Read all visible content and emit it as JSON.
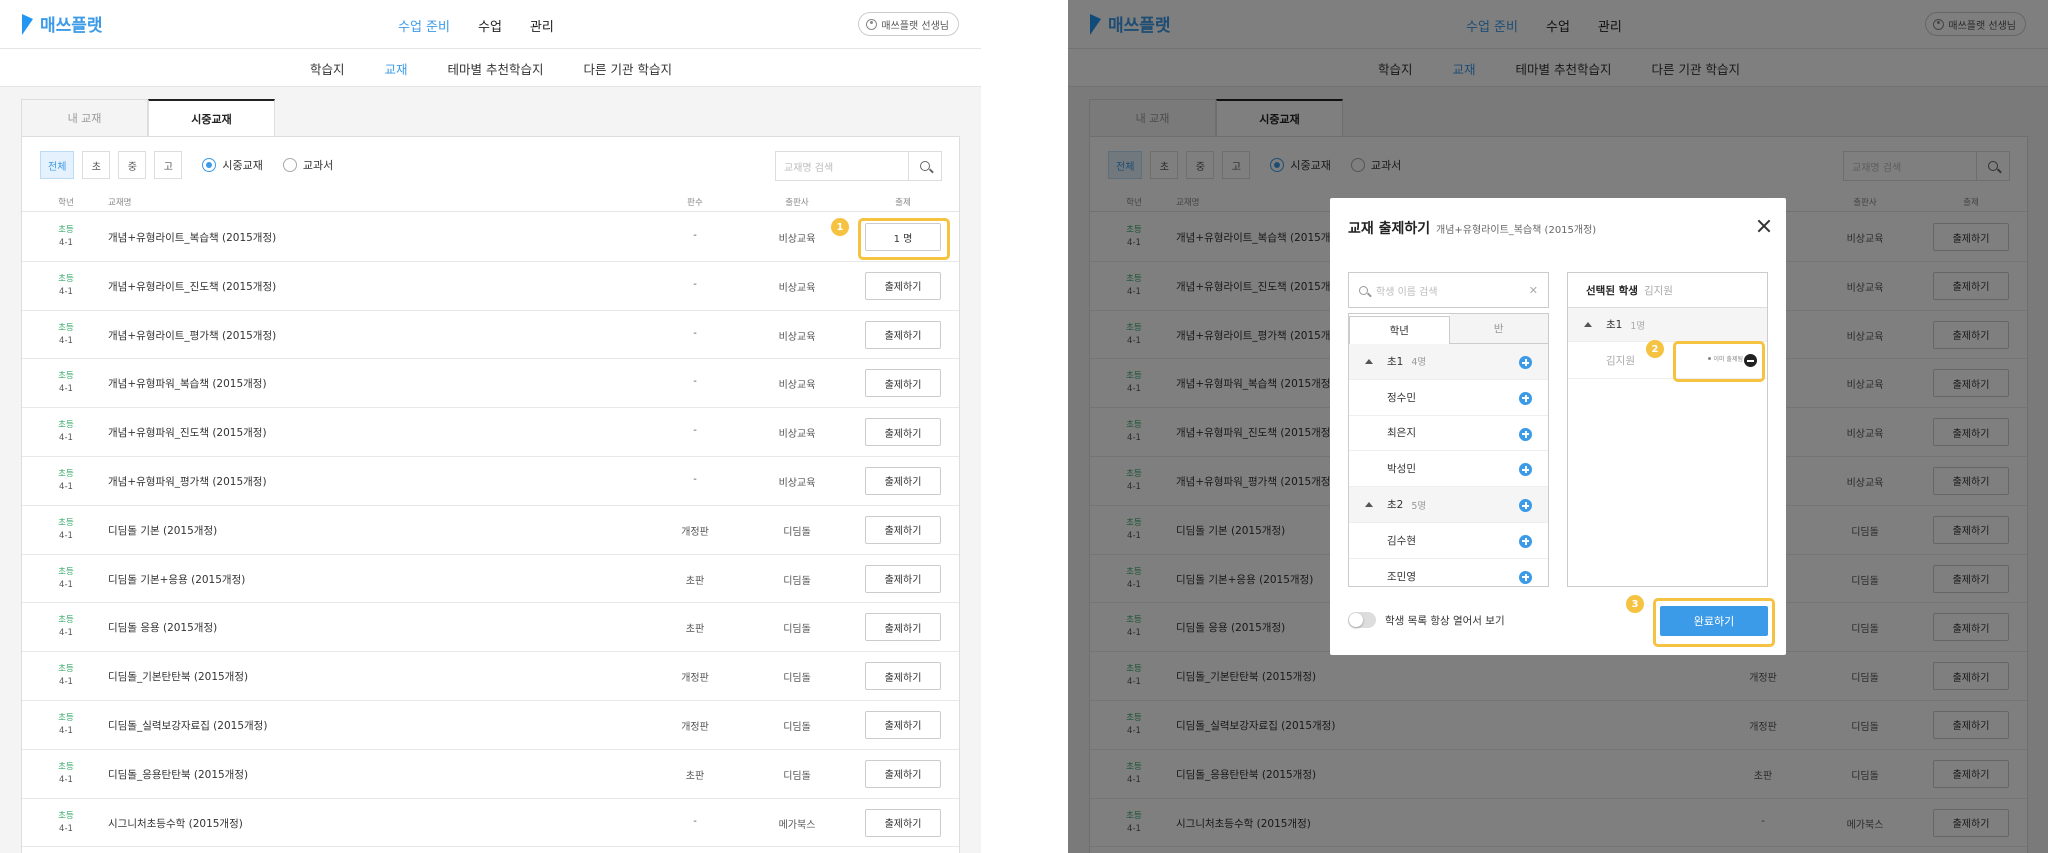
{
  "app": {
    "logo": "매쓰플랫",
    "nav": [
      "수업 준비",
      "수업",
      "관리"
    ],
    "profile": "매쓰플랫 선생님",
    "subnav": [
      "학습지",
      "교재",
      "테마별 추천학습지",
      "다른 기관 학습지"
    ]
  },
  "tabs": [
    "내 교재",
    "시중교재"
  ],
  "filters": {
    "buttons": [
      "전체",
      "초",
      "중",
      "고"
    ],
    "radios": [
      "시중교재",
      "교과서"
    ],
    "search_placeholder": "교재명 검색"
  },
  "columns": [
    "학년",
    "교재명",
    "판수",
    "출판사",
    "출제"
  ],
  "books": [
    {
      "level": "초등",
      "grade": "4-1",
      "title": "개념+유형라이트_복습책 (2015개정)",
      "edition": "-",
      "publisher": "비상교육",
      "action": "1 명"
    },
    {
      "level": "초등",
      "grade": "4-1",
      "title": "개념+유형라이트_진도책 (2015개정)",
      "edition": "-",
      "publisher": "비상교육",
      "action": "출제하기"
    },
    {
      "level": "초등",
      "grade": "4-1",
      "title": "개념+유형라이트_평가책 (2015개정)",
      "edition": "-",
      "publisher": "비상교육",
      "action": "출제하기"
    },
    {
      "level": "초등",
      "grade": "4-1",
      "title": "개념+유형파워_복습책 (2015개정)",
      "edition": "-",
      "publisher": "비상교육",
      "action": "출제하기"
    },
    {
      "level": "초등",
      "grade": "4-1",
      "title": "개념+유형파워_진도책 (2015개정)",
      "edition": "-",
      "publisher": "비상교육",
      "action": "출제하기"
    },
    {
      "level": "초등",
      "grade": "4-1",
      "title": "개념+유형파워_평가책 (2015개정)",
      "edition": "-",
      "publisher": "비상교육",
      "action": "출제하기"
    },
    {
      "level": "초등",
      "grade": "4-1",
      "title": "디딤돌 기본 (2015개정)",
      "edition": "개정판",
      "publisher": "디딤돌",
      "action": "출제하기"
    },
    {
      "level": "초등",
      "grade": "4-1",
      "title": "디딤돌 기본+응용 (2015개정)",
      "edition": "초판",
      "publisher": "디딤돌",
      "action": "출제하기"
    },
    {
      "level": "초등",
      "grade": "4-1",
      "title": "디딤돌 응용 (2015개정)",
      "edition": "초판",
      "publisher": "디딤돌",
      "action": "출제하기"
    },
    {
      "level": "초등",
      "grade": "4-1",
      "title": "디딤돌_기본탄탄북 (2015개정)",
      "edition": "개정판",
      "publisher": "디딤돌",
      "action": "출제하기"
    },
    {
      "level": "초등",
      "grade": "4-1",
      "title": "디딤돌_실력보강자료집 (2015개정)",
      "edition": "개정판",
      "publisher": "디딤돌",
      "action": "출제하기"
    },
    {
      "level": "초등",
      "grade": "4-1",
      "title": "디딤돌_응용탄탄북 (2015개정)",
      "edition": "초판",
      "publisher": "디딤돌",
      "action": "출제하기"
    },
    {
      "level": "초등",
      "grade": "4-1",
      "title": "시그니처초등수학 (2015개정)",
      "edition": "-",
      "publisher": "메가북스",
      "action": "출제하기"
    }
  ],
  "right_books_first_action": "출제하기",
  "callouts": [
    "1",
    "2",
    "3"
  ],
  "modal": {
    "title": "교재 출제하기",
    "subtitle": "개념+유형라이트_복습책 (2015개정)",
    "search_placeholder": "학생 이름 검색",
    "tabs": [
      "학년",
      "반"
    ],
    "groups": [
      {
        "name": "초1",
        "count": "4명",
        "students": [
          "정수민",
          "최은지",
          "박성민"
        ]
      },
      {
        "name": "초2",
        "count": "5명",
        "students": [
          "김수현",
          "조민영"
        ]
      }
    ],
    "selected_title": "선택된 학생",
    "selected_names": "김지원",
    "selected_group": "초1",
    "selected_group_count": "1명",
    "selected_student": "김지원",
    "assigned_label": "이미 출제됨",
    "toggle_label": "학생 목록 항상 열어서 보기",
    "done_button": "완료하기"
  },
  "colors": {
    "accent": "#3c9be8",
    "highlight": "#f5c242",
    "grade": "#3aaa6c"
  }
}
